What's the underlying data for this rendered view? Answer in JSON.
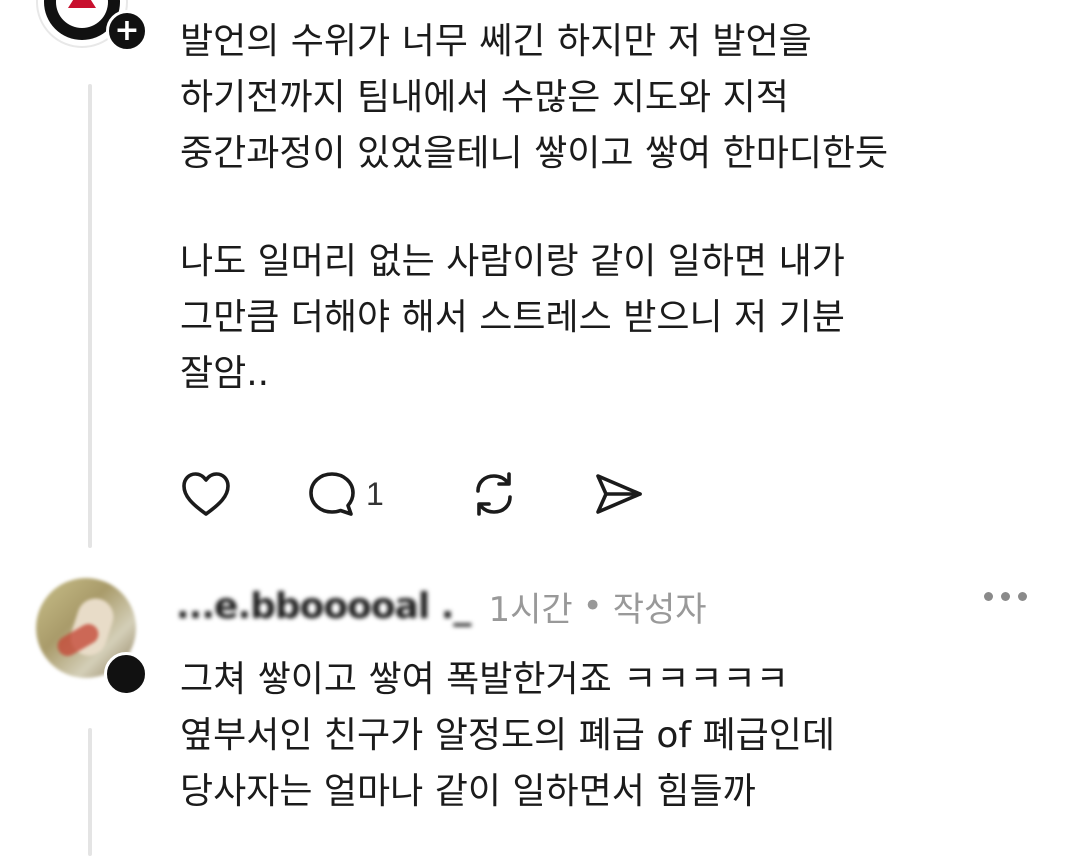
{
  "comment1": {
    "paragraphs": [
      "발언의 수위가 너무 쎄긴 하지만 저 발언을\n하기전까지 팀내에서 수많은 지도와 지적\n중간과정이 있었을테니 쌓이고 쌓여 한마디한듯",
      "나도 일머리 없는 사람이랑 같이 일하면 내가\n그만큼 더해야 해서 스트레스 받으니 저 기분\n잘암.."
    ],
    "actions": {
      "like_icon": "heart-icon",
      "reply_icon": "speech-bubble-icon",
      "reply_count": "1",
      "repost_icon": "repost-icon",
      "share_icon": "send-icon"
    }
  },
  "comment2": {
    "username": "...e.bbooooal ._",
    "time": "1시간",
    "separator": "•",
    "role": "작성자",
    "text": "그쳐 쌓이고 쌓여 폭발한거죠 ㅋㅋㅋㅋㅋ\n옆부서인 친구가 알정도의 폐급 of 폐급인데\n당사자는 얼마나 같이 일하면서 힘들까"
  },
  "colors": {
    "text": "#1b1b1b",
    "meta": "#999999",
    "thread_line": "#e4e4e4",
    "badge": "#111111"
  }
}
